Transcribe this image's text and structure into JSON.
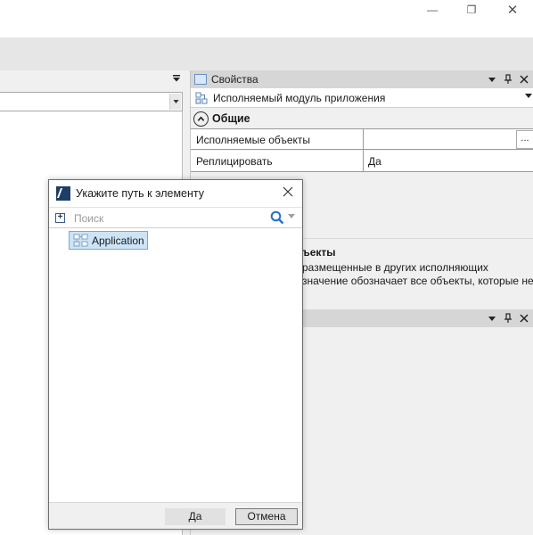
{
  "window": {
    "minimize_glyph": "—",
    "restore_glyph": "❐",
    "close_glyph": "✕"
  },
  "properties": {
    "title": "Свойства",
    "selected_object": "Исполняемый модуль приложения",
    "group_label": "Общие",
    "rows": [
      {
        "key": "Исполняемые объекты",
        "value": ""
      },
      {
        "key": "Реплицировать",
        "value": "Да"
      }
    ],
    "ellipsis": "...",
    "description_title": "ъекты",
    "description_lines": [
      "размещенные в других исполняющих",
      "значение обозначает все объекты, которые не"
    ]
  },
  "dialog": {
    "title": "Укажите путь к элементу",
    "search_placeholder": "Поиск",
    "tree_items": [
      {
        "label": "Application"
      }
    ],
    "ok_label": "Да",
    "cancel_label": "Отмена"
  },
  "icons": {
    "panel": "panel-icon",
    "module": "module-icon",
    "collapse": "chevron-up-icon",
    "search": "search-icon",
    "app": "application-icon",
    "close": "close-icon",
    "pin": "pin-icon",
    "dropdown": "dropdown-arrow-icon"
  },
  "colors": {
    "selection": "#cde4f7",
    "selection_border": "#7aa8d4",
    "search_icon": "#2a6fc4",
    "panel_header": "#d6d6d6"
  }
}
